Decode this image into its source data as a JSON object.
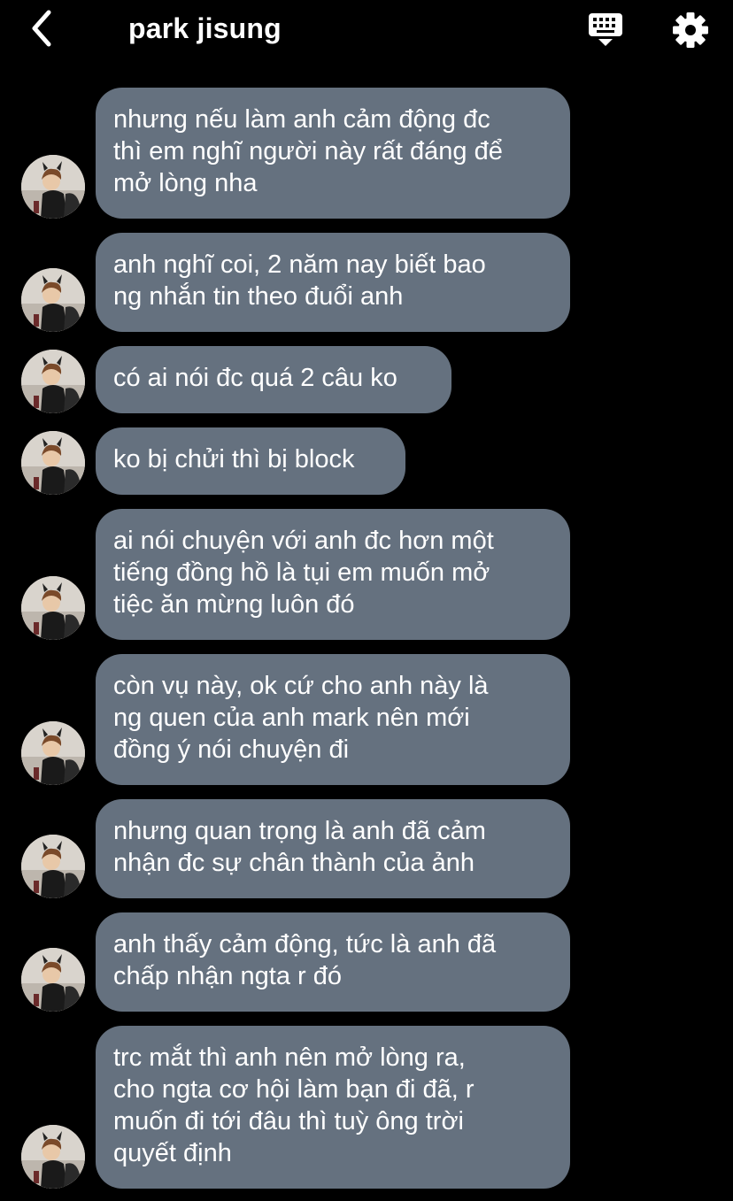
{
  "header": {
    "title": "park jisung",
    "back_icon": "chevron-left-icon",
    "keyboard_icon": "keyboard-hide-icon",
    "settings_icon": "gear-icon"
  },
  "colors": {
    "background": "#000000",
    "bubble": "#65717f",
    "text": "#ffffff"
  },
  "messages": [
    {
      "text": "nhưng nếu làm anh cảm động đc\nthì em nghĩ người này rất đáng để\nmở lòng nha"
    },
    {
      "text": "anh nghĩ coi, 2 năm nay biết bao\nng nhắn tin theo đuổi anh"
    },
    {
      "text": "có ai nói đc quá 2 câu ko"
    },
    {
      "text": "ko bị chửi thì bị block"
    },
    {
      "text": "ai nói chuyện với anh đc hơn một\ntiếng đồng hồ là tụi em muốn mở\ntiệc ăn mừng luôn đó"
    },
    {
      "text": "còn vụ này, ok cứ cho anh này là\nng quen của anh mark nên mới\nđồng ý nói chuyện đi"
    },
    {
      "text": "nhưng quan trọng là anh đã cảm\nnhận đc sự chân thành của ảnh"
    },
    {
      "text": "anh thấy cảm động, tức là anh đã\nchấp nhận ngta r đó"
    },
    {
      "text": "trc mắt thì anh nên mở lòng ra,\ncho ngta cơ hội làm bạn đi đã, r\nmuốn đi tới đâu thì tuỳ ông trời\nquyết định"
    }
  ]
}
